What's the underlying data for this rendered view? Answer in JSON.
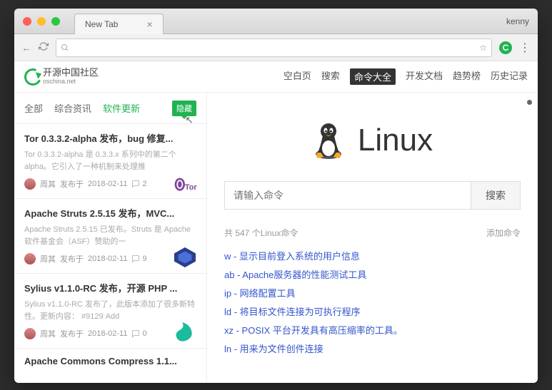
{
  "browser": {
    "tab_title": "New Tab",
    "user": "kenny"
  },
  "sitenav": [
    "空白页",
    "搜索",
    "命令大全",
    "开发文档",
    "趋势榜",
    "历史记录"
  ],
  "logo": {
    "line1": "开源中国社区",
    "line2": "oschina.net"
  },
  "subtabs": {
    "items": [
      "全部",
      "综合资讯",
      "软件更新"
    ],
    "hide": "隐藏"
  },
  "articles": [
    {
      "title": "Tor 0.3.3.2-alpha 发布，bug 修复...",
      "desc": "Tor 0.3.3.2-alpha 是 0.3.3.x 系列中的第二个 alpha。它引入了一种机制来处理推",
      "author": "周其",
      "pub": "发布于",
      "date": "2018-02-11",
      "comments": "2"
    },
    {
      "title": "Apache Struts 2.5.15 发布，MVC...",
      "desc": "Apache Struts 2.5.15 已发布。Struts 是 Apache软件基金会（ASF）赞助的一",
      "author": "周其",
      "pub": "发布于",
      "date": "2018-02-11",
      "comments": "9"
    },
    {
      "title": "Sylius v1.1.0-RC 发布，开源 PHP ...",
      "desc": "Sylius v1.1.0-RC 发布了，此版本添加了很多新特性。更新内容： #9129 Add",
      "author": "周其",
      "pub": "发布于",
      "date": "2018-02-11",
      "comments": "0"
    },
    {
      "title": "Apache Commons Compress 1.1...",
      "desc": "",
      "author": "",
      "pub": "",
      "date": "",
      "comments": ""
    }
  ],
  "hero": "Linux",
  "search": {
    "placeholder": "请输入命令",
    "button": "搜索"
  },
  "cmd_total": "共 547 个Linux命令",
  "cmd_add": "添加命令",
  "commands": [
    "w - 显示目前登入系统的用户信息",
    "ab - Apache服务器的性能测试工具",
    "ip - 网络配置工具",
    "ld - 将目标文件连接为可执行程序",
    "xz - POSIX 平台开发具有高压缩率的工具。",
    "ln - 用来为文件创件连接"
  ]
}
